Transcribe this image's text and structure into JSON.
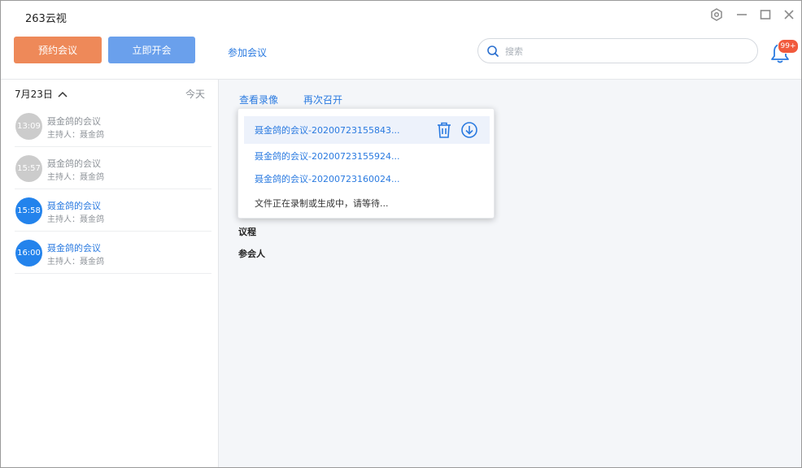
{
  "app": {
    "title": "263云视",
    "window_controls": [
      "settings-icon",
      "minimize-icon",
      "maximize-icon",
      "close-icon"
    ]
  },
  "toolbar": {
    "schedule_label": "预约会议",
    "start_now_label": "立即开会",
    "join_label": "参加会议",
    "search_placeholder": "搜索",
    "notification_badge": "99+"
  },
  "colors": {
    "schedule_button": "#ee8959",
    "start_button": "#6aa0ec",
    "link": "#2a7ae0",
    "active_circle": "#2383ec",
    "past_circle": "#cccccc",
    "badge": "#f15a3d"
  },
  "sidebar": {
    "date": "7月23日",
    "today_label": "今天",
    "meetings": [
      {
        "time": "13:09",
        "title": "聂金鸽的会议",
        "host": "主持人：聂金鸽",
        "state": "past"
      },
      {
        "time": "15:57",
        "title": "聂金鸽的会议",
        "host": "主持人：聂金鸽",
        "state": "past"
      },
      {
        "time": "15:58",
        "title": "聂金鸽的会议",
        "host": "主持人：聂金鸽",
        "state": "active"
      },
      {
        "time": "16:00",
        "title": "聂金鸽的会议",
        "host": "主持人：聂金鸽",
        "state": "active"
      }
    ]
  },
  "main": {
    "tabs": [
      "查看录像",
      "再次召开"
    ],
    "agenda_label": "议程",
    "participants_label": "参会人"
  },
  "recordings_popup": {
    "items": [
      "聂金鸽的会议-20200723155843...",
      "聂金鸽的会议-20200723155924...",
      "聂金鸽的会议-20200723160024..."
    ],
    "status": "文件正在录制或生成中，请等待..."
  }
}
